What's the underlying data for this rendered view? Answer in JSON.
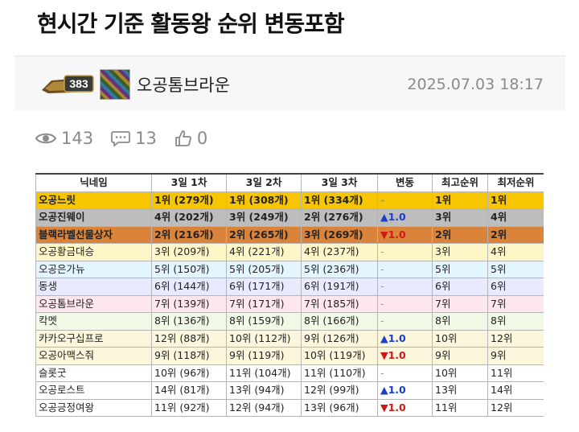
{
  "post": {
    "title": "현시간 기준 활동왕 순위 변동포함",
    "level": "383",
    "author": "오공톰브라운",
    "date": "2025.07.03 18:17",
    "views": "143",
    "comments": "13",
    "likes": "0"
  },
  "table": {
    "headers": [
      "닉네임",
      "3일 1차",
      "3일 2차",
      "3일 3차",
      "변동",
      "최고순위",
      "최저순위"
    ],
    "rows": [
      {
        "name": "오공느릿",
        "d1": "1위 (279개)",
        "d2": "1위 (308개)",
        "d3": "1위 (334개)",
        "change": "-",
        "dir": "none",
        "best": "1위",
        "worst": "1위",
        "bg": "#f7c600",
        "bold": true
      },
      {
        "name": "오공진웨이",
        "d1": "4위 (202개)",
        "d2": "3위 (249개)",
        "d3": "2위 (276개)",
        "change": "▲1.0",
        "dir": "up",
        "best": "3위",
        "worst": "4위",
        "bg": "#bdbdbd",
        "bold": true
      },
      {
        "name": "블랙라벨선물상자",
        "d1": "2위 (216개)",
        "d2": "2위 (265개)",
        "d3": "3위 (269개)",
        "change": "▼1.0",
        "dir": "down",
        "best": "2위",
        "worst": "2위",
        "bg": "#d9843a",
        "bold": true
      },
      {
        "name": "오공황금대승",
        "d1": "3위 (209개)",
        "d2": "4위 (221개)",
        "d3": "4위 (237개)",
        "change": "-",
        "dir": "none",
        "best": "3위",
        "worst": "4위",
        "bg": "#fff6c8",
        "bold": false
      },
      {
        "name": "오공은가뉴",
        "d1": "5위 (150개)",
        "d2": "5위 (205개)",
        "d3": "5위 (236개)",
        "change": "-",
        "dir": "none",
        "best": "5위",
        "worst": "5위",
        "bg": "#e3f5ff",
        "bold": false
      },
      {
        "name": "동생",
        "d1": "6위 (144개)",
        "d2": "6위 (171개)",
        "d3": "6위 (191개)",
        "change": "-",
        "dir": "none",
        "best": "6위",
        "worst": "6위",
        "bg": "#eaeaff",
        "bold": false
      },
      {
        "name": "오공톰브라운",
        "d1": "7위 (139개)",
        "d2": "7위 (171개)",
        "d3": "7위 (185개)",
        "change": "-",
        "dir": "none",
        "best": "7위",
        "worst": "7위",
        "bg": "#fde6ec",
        "bold": false
      },
      {
        "name": "칵멧",
        "d1": "8위 (136개)",
        "d2": "8위 (159개)",
        "d3": "8위 (166개)",
        "change": "-",
        "dir": "none",
        "best": "8위",
        "worst": "8위",
        "bg": "#f0fae6",
        "bold": false
      },
      {
        "name": "카카오구십프로",
        "d1": "12위 (88개)",
        "d2": "10위 (112개)",
        "d3": "9위 (126개)",
        "change": "▲1.0",
        "dir": "up",
        "best": "10위",
        "worst": "12위",
        "bg": "#fbf6dc",
        "bold": false
      },
      {
        "name": "오공아맥스줘",
        "d1": "9위 (118개)",
        "d2": "9위 (119개)",
        "d3": "10위 (119개)",
        "change": "▼1.0",
        "dir": "down",
        "best": "9위",
        "worst": "9위",
        "bg": "#fbf6dc",
        "bold": false
      },
      {
        "name": "슬롯굿",
        "d1": "10위 (96개)",
        "d2": "11위 (104개)",
        "d3": "11위 (110개)",
        "change": "-",
        "dir": "none",
        "best": "10위",
        "worst": "11위",
        "bg": "#ffffff",
        "bold": false
      },
      {
        "name": "오공로스트",
        "d1": "14위 (81개)",
        "d2": "13위 (94개)",
        "d3": "12위 (99개)",
        "change": "▲1.0",
        "dir": "up",
        "best": "13위",
        "worst": "14위",
        "bg": "#ffffff",
        "bold": false
      },
      {
        "name": "오공긍정여왕",
        "d1": "11위 (92개)",
        "d2": "12위 (94개)",
        "d3": "13위 (96개)",
        "change": "▼1.0",
        "dir": "down",
        "best": "11위",
        "worst": "12위",
        "bg": "#ffffff",
        "bold": false
      }
    ]
  }
}
